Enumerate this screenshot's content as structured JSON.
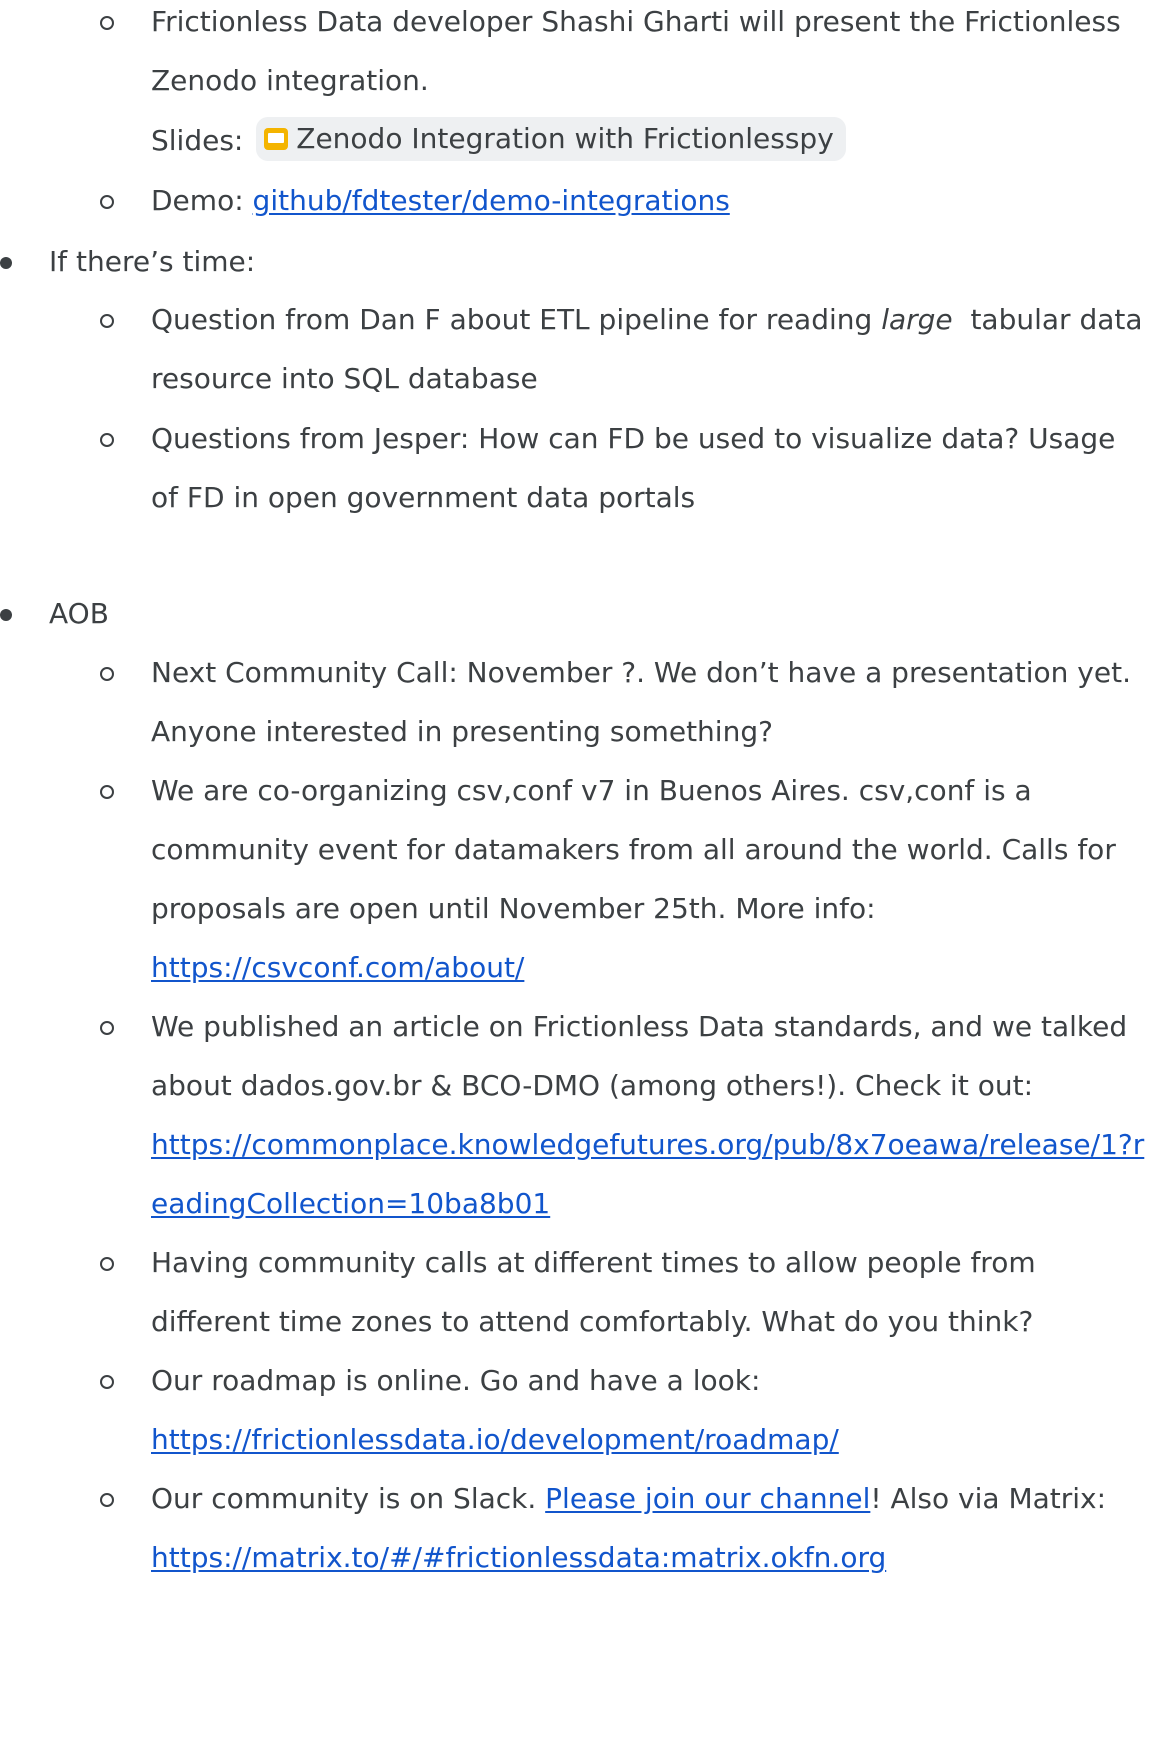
{
  "colors": {
    "text": "#3c4043",
    "link": "#1155cc",
    "chip_bg": "#eef0f2",
    "slides_icon": "#f4b400"
  },
  "items": {
    "zenodo_line1": "Frictionless Data developer Shashi Gharti will present the Frictionless",
    "zenodo_line2": "Zenodo integration.",
    "slides_label": "Slides:",
    "slides_chip": "Zenodo Integration with Frictionlesspy",
    "demo_label": "Demo:",
    "demo_link": "github/fdtester/demo-integrations",
    "if_time": "If there’s time:",
    "dan_line1_a": "Question from Dan F about ETL pipeline for reading ",
    "dan_line1_em": "large",
    "dan_line1_b": "  tabular data",
    "dan_line2": "resource into SQL database",
    "jesper_line1": "Questions from Jesper: How can FD be used to visualize data? Usage",
    "jesper_line2": "of FD in open government data portals",
    "aob": "AOB",
    "next_call_line1": "Next Community Call: November ?. We don’t have a presentation yet.",
    "next_call_line2": "Anyone interested in presenting something?",
    "csvconf_line1": "We are co-organizing csv,conf v7 in Buenos Aires. csv,conf is a",
    "csvconf_line2": "community event for datamakers from all around the world. Calls for",
    "csvconf_line3": "proposals are open until November 25th. More info:",
    "csvconf_link": "https://csvconf.com/about/",
    "article_line1": "We published an article on Frictionless Data standards, and we talked",
    "article_line2": "about dados.gov.br & BCO-DMO (among others!). Check it out:",
    "article_link1": "https://commonplace.knowledgefutures.org/pub/8x7oeawa/release/1?r",
    "article_link2": "eadingCollection=10ba8b01",
    "times_line1": "Having community calls at different times to allow people from",
    "times_line2": "different time zones to attend comfortably. What do you think?",
    "roadmap_line1": "Our roadmap is online. Go and have a look:",
    "roadmap_link": "https://frictionlessdata.io/development/roadmap/",
    "slack_a": "Our community is on Slack. ",
    "slack_link": "Please join our channel",
    "slack_b": "! Also via Matrix:",
    "matrix_link": "https://matrix.to/#/#frictionlessdata:matrix.okfn.org"
  }
}
